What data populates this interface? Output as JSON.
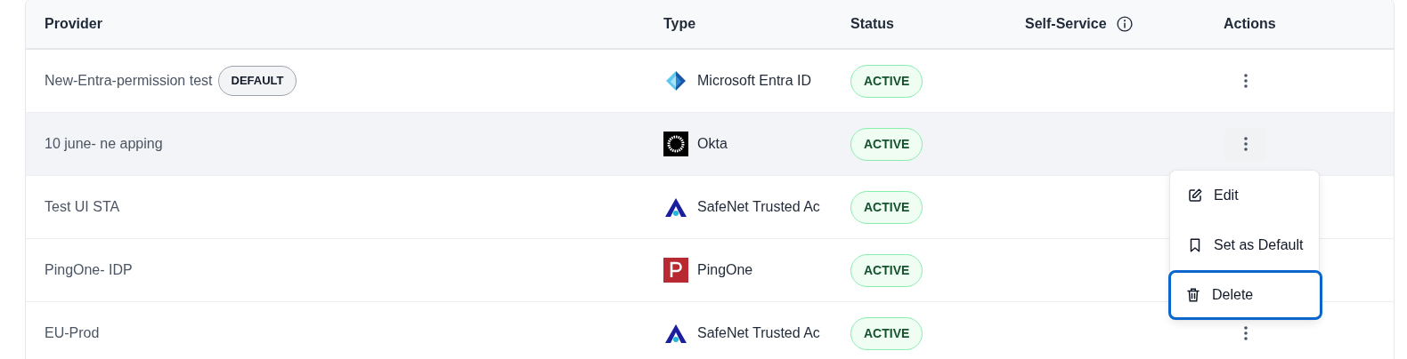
{
  "table": {
    "columns": [
      {
        "label": "Provider"
      },
      {
        "label": "Type"
      },
      {
        "label": "Status"
      },
      {
        "label": "Self-Service",
        "info": true
      },
      {
        "label": "Actions"
      }
    ],
    "rows": [
      {
        "provider": "New-Entra-permission test",
        "badge": "DEFAULT",
        "type": {
          "kind": "entra",
          "label": "Microsoft Entra ID"
        },
        "status": "ACTIVE",
        "hovered": false
      },
      {
        "provider": "10 june- ne apping",
        "type": {
          "kind": "okta",
          "label": "Okta"
        },
        "status": "ACTIVE",
        "hovered": true
      },
      {
        "provider": "Test UI STA",
        "type": {
          "kind": "safenet",
          "label": "SafeNet Trusted Ac"
        },
        "status": "ACTIVE",
        "hovered": false
      },
      {
        "provider": "PingOne- IDP",
        "type": {
          "kind": "pingone",
          "label": "PingOne"
        },
        "status": "ACTIVE",
        "hovered": false
      },
      {
        "provider": "EU-Prod",
        "type": {
          "kind": "safenet",
          "label": "SafeNet Trusted Ac"
        },
        "status": "ACTIVE",
        "hovered": false
      }
    ]
  },
  "action_menu": {
    "items": [
      {
        "kind": "edit",
        "label": "Edit",
        "focused": false
      },
      {
        "kind": "bookmark",
        "label": "Set as Default",
        "focused": false
      },
      {
        "kind": "trash",
        "label": "Delete",
        "focused": true
      }
    ]
  }
}
